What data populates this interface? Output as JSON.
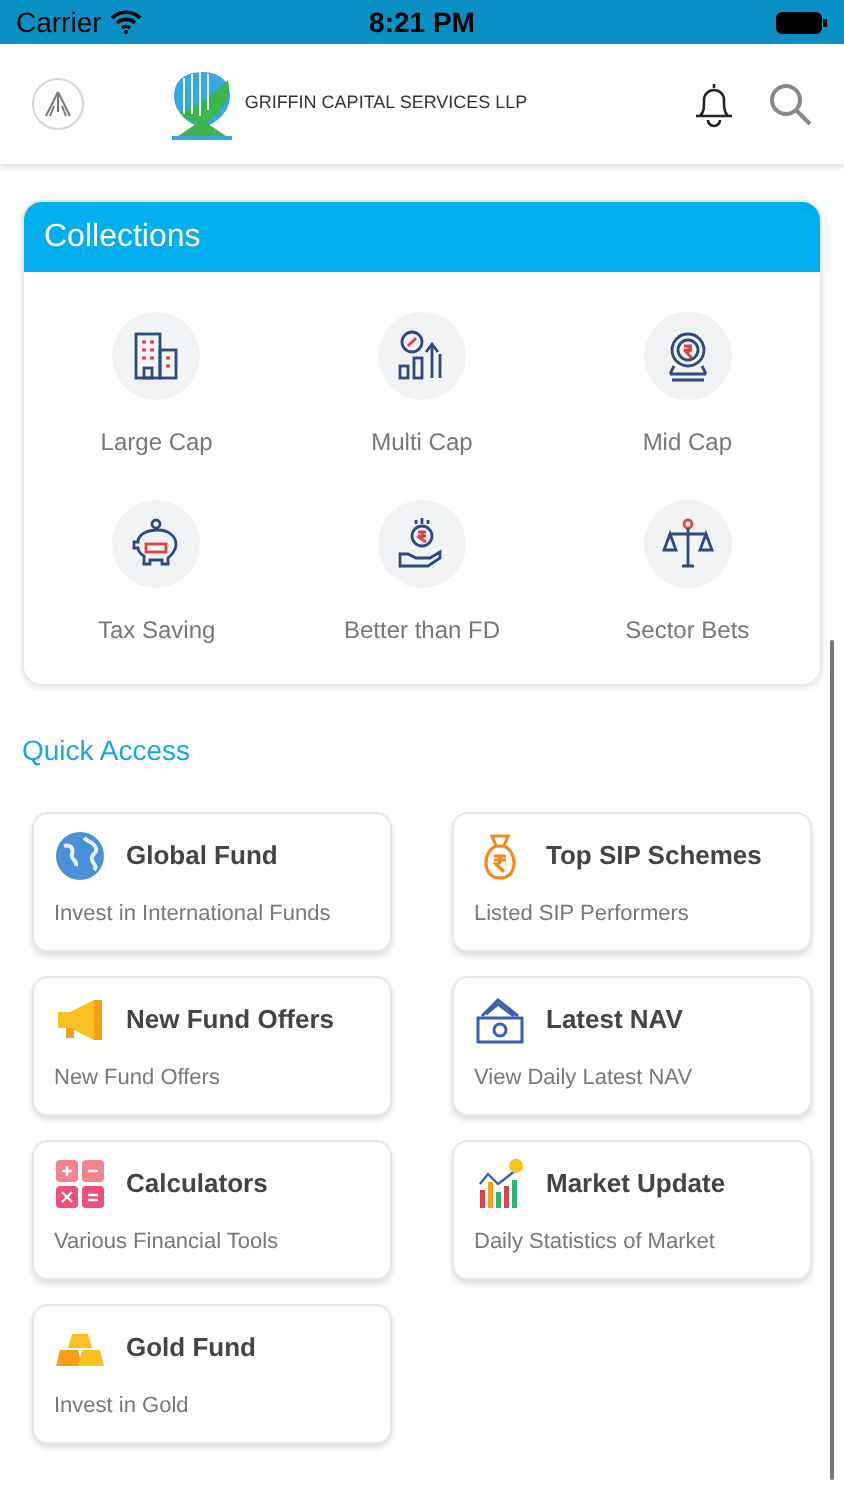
{
  "status_bar": {
    "carrier": "Carrier",
    "time": "8:21 PM"
  },
  "header": {
    "brand": "GRIFFIN CAPITAL SERVICES LLP"
  },
  "collections": {
    "title": "Collections",
    "items": [
      {
        "label": "Large Cap"
      },
      {
        "label": "Multi Cap"
      },
      {
        "label": "Mid Cap"
      },
      {
        "label": "Tax Saving"
      },
      {
        "label": "Better than FD"
      },
      {
        "label": "Sector Bets"
      }
    ]
  },
  "quick_access": {
    "title": "Quick Access",
    "items": [
      {
        "title": "Global Fund",
        "subtitle": "Invest in International Funds"
      },
      {
        "title": "Top SIP Schemes",
        "subtitle": "Listed SIP Performers"
      },
      {
        "title": "New Fund Offers",
        "subtitle": "New Fund Offers"
      },
      {
        "title": "Latest NAV",
        "subtitle": "View Daily Latest NAV"
      },
      {
        "title": "Calculators",
        "subtitle": "Various Financial Tools"
      },
      {
        "title": "Market Update",
        "subtitle": "Daily Statistics of Market"
      },
      {
        "title": "Gold Fund",
        "subtitle": "Invest in Gold"
      }
    ]
  }
}
